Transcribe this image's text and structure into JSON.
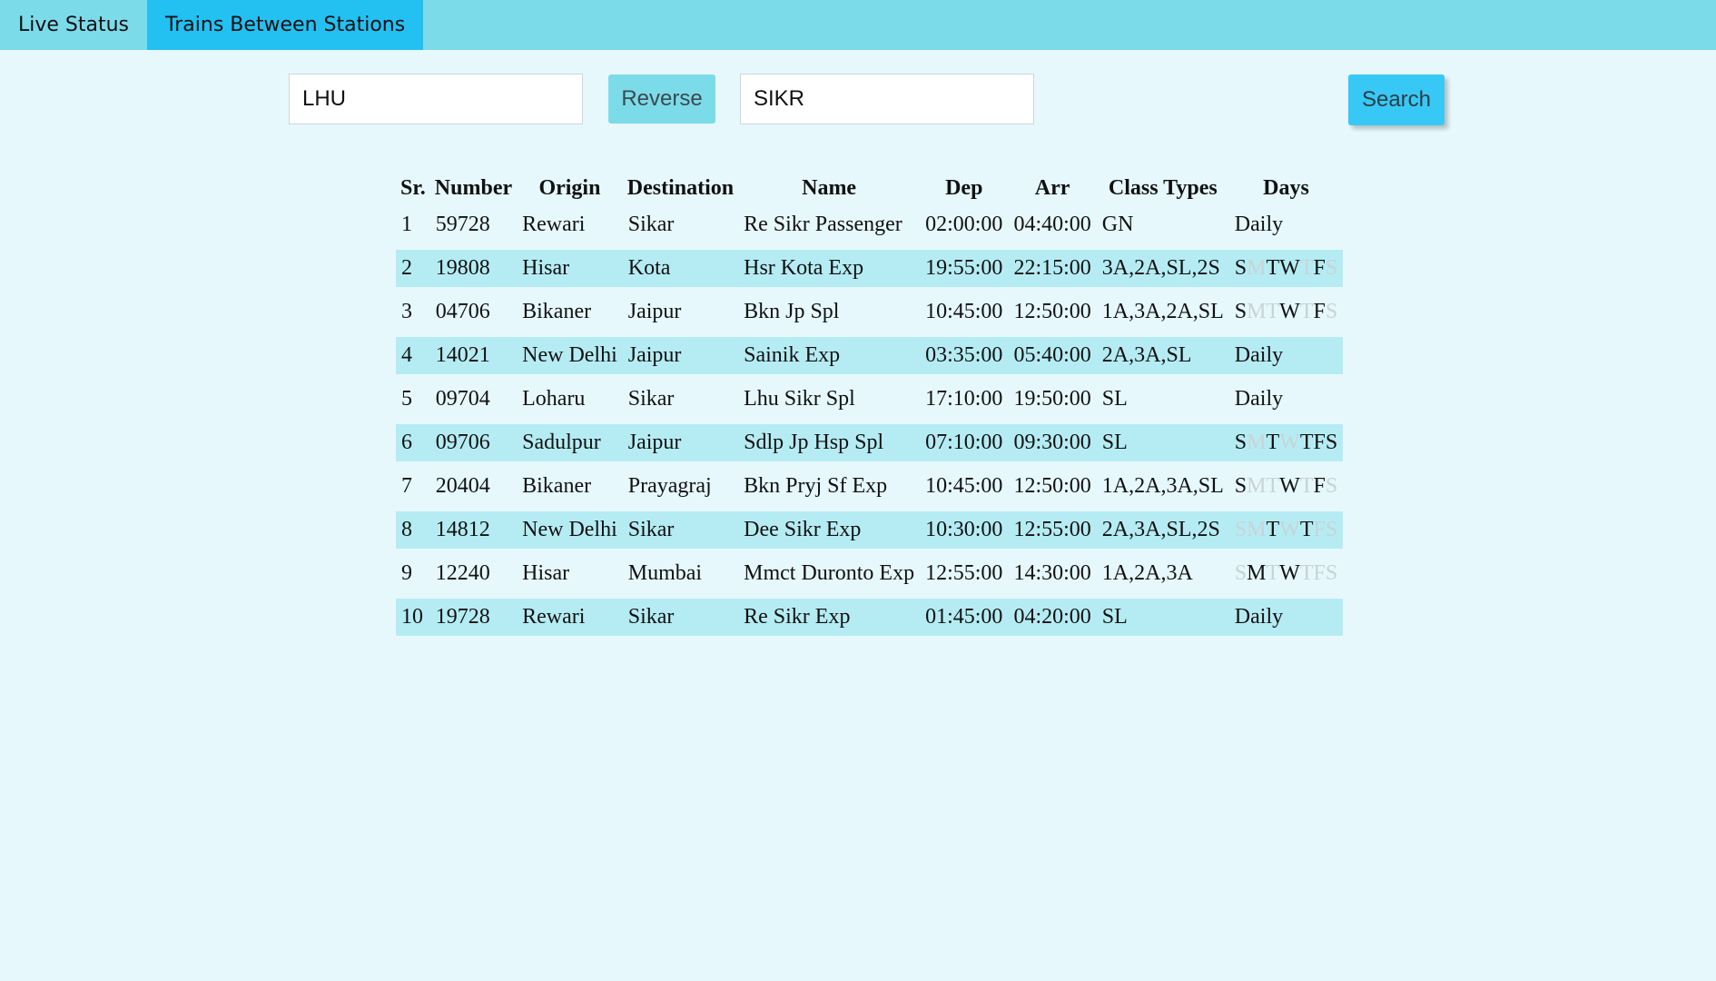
{
  "tabs": [
    {
      "label": "Live Status",
      "active": false
    },
    {
      "label": "Trains Between Stations",
      "active": true
    }
  ],
  "search": {
    "from_value": "LHU",
    "to_value": "SIKR",
    "reverse_label": "Reverse",
    "search_label": "Search"
  },
  "table": {
    "headers": [
      "Sr.",
      "Number",
      "Origin",
      "Destination",
      "Name",
      "Dep",
      "Arr",
      "Class Types",
      "Days"
    ],
    "rows": [
      {
        "sr": "1",
        "number": "59728",
        "origin": "Rewari",
        "destination": "Sikar",
        "name": "Re Sikr Passenger",
        "dep": "02:00:00",
        "arr": "04:40:00",
        "classes": "GN",
        "days": "Daily"
      },
      {
        "sr": "2",
        "number": "19808",
        "origin": "Hisar",
        "destination": "Kota",
        "name": "Hsr Kota Exp",
        "dep": "19:55:00",
        "arr": "22:15:00",
        "classes": "3A,2A,SL,2S",
        "days": [
          {
            "d": "S",
            "on": true
          },
          {
            "d": "M",
            "on": false
          },
          {
            "d": "T",
            "on": true
          },
          {
            "d": "W",
            "on": true
          },
          {
            "d": "T",
            "on": false
          },
          {
            "d": "F",
            "on": true
          },
          {
            "d": "S",
            "on": false
          }
        ]
      },
      {
        "sr": "3",
        "number": "04706",
        "origin": "Bikaner",
        "destination": "Jaipur",
        "name": "Bkn Jp Spl",
        "dep": "10:45:00",
        "arr": "12:50:00",
        "classes": "1A,3A,2A,SL",
        "days": [
          {
            "d": "S",
            "on": true
          },
          {
            "d": "M",
            "on": false
          },
          {
            "d": "T",
            "on": false
          },
          {
            "d": "W",
            "on": true
          },
          {
            "d": "T",
            "on": false
          },
          {
            "d": "F",
            "on": true
          },
          {
            "d": "S",
            "on": false
          }
        ]
      },
      {
        "sr": "4",
        "number": "14021",
        "origin": "New Delhi",
        "destination": "Jaipur",
        "name": "Sainik Exp",
        "dep": "03:35:00",
        "arr": "05:40:00",
        "classes": "2A,3A,SL",
        "days": "Daily"
      },
      {
        "sr": "5",
        "number": "09704",
        "origin": "Loharu",
        "destination": "Sikar",
        "name": "Lhu Sikr Spl",
        "dep": "17:10:00",
        "arr": "19:50:00",
        "classes": "SL",
        "days": "Daily"
      },
      {
        "sr": "6",
        "number": "09706",
        "origin": "Sadulpur",
        "destination": "Jaipur",
        "name": "Sdlp Jp Hsp Spl",
        "dep": "07:10:00",
        "arr": "09:30:00",
        "classes": "SL",
        "days": [
          {
            "d": "S",
            "on": true
          },
          {
            "d": "M",
            "on": false
          },
          {
            "d": "T",
            "on": true
          },
          {
            "d": "W",
            "on": false
          },
          {
            "d": "T",
            "on": true
          },
          {
            "d": "F",
            "on": true
          },
          {
            "d": "S",
            "on": true
          }
        ]
      },
      {
        "sr": "7",
        "number": "20404",
        "origin": "Bikaner",
        "destination": "Prayagraj",
        "name": "Bkn Pryj Sf Exp",
        "dep": "10:45:00",
        "arr": "12:50:00",
        "classes": "1A,2A,3A,SL",
        "days": [
          {
            "d": "S",
            "on": true
          },
          {
            "d": "M",
            "on": false
          },
          {
            "d": "T",
            "on": false
          },
          {
            "d": "W",
            "on": true
          },
          {
            "d": "T",
            "on": false
          },
          {
            "d": "F",
            "on": true
          },
          {
            "d": "S",
            "on": false
          }
        ]
      },
      {
        "sr": "8",
        "number": "14812",
        "origin": "New Delhi",
        "destination": "Sikar",
        "name": "Dee Sikr Exp",
        "dep": "10:30:00",
        "arr": "12:55:00",
        "classes": "2A,3A,SL,2S",
        "days": [
          {
            "d": "S",
            "on": false
          },
          {
            "d": "M",
            "on": false
          },
          {
            "d": "T",
            "on": true
          },
          {
            "d": "W",
            "on": false
          },
          {
            "d": "T",
            "on": true
          },
          {
            "d": "F",
            "on": false
          },
          {
            "d": "S",
            "on": false
          }
        ]
      },
      {
        "sr": "9",
        "number": "12240",
        "origin": "Hisar",
        "destination": "Mumbai",
        "name": "Mmct Duronto Exp",
        "dep": "12:55:00",
        "arr": "14:30:00",
        "classes": "1A,2A,3A",
        "days": [
          {
            "d": "S",
            "on": false
          },
          {
            "d": "M",
            "on": true
          },
          {
            "d": "T",
            "on": false
          },
          {
            "d": "W",
            "on": true
          },
          {
            "d": "T",
            "on": false
          },
          {
            "d": "F",
            "on": false
          },
          {
            "d": "S",
            "on": false
          }
        ]
      },
      {
        "sr": "10",
        "number": "19728",
        "origin": "Rewari",
        "destination": "Sikar",
        "name": "Re Sikr Exp",
        "dep": "01:45:00",
        "arr": "04:20:00",
        "classes": "SL",
        "days": "Daily"
      }
    ]
  },
  "colors": {
    "background": "#e6f8fc",
    "tabbar": "#7cdbe9",
    "tab_active": "#23c0f2",
    "row_stripe": "#b5ecf4",
    "day_off": "#c9d3d6"
  }
}
